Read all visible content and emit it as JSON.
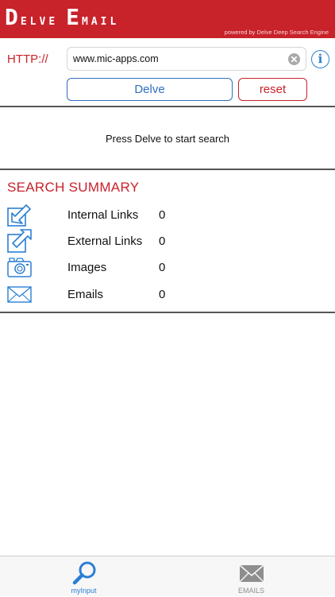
{
  "app": {
    "logo_word1_initial": "D",
    "logo_word1_rest": "ELVE",
    "logo_word2_initial": "E",
    "logo_word2_rest": "MAIL",
    "powered_by": "powered by Delve Deep Search Engine"
  },
  "input": {
    "protocol_label": "HTTP://",
    "url_value": "www.mic-apps.com",
    "clear_icon": "clear-icon",
    "info_icon": "info-icon",
    "info_glyph": "i"
  },
  "actions": {
    "delve_label": "Delve",
    "reset_label": "reset"
  },
  "status": {
    "message": "Press Delve to start search"
  },
  "summary": {
    "title": "SEARCH SUMMARY",
    "rows": [
      {
        "icon": "internal-link-icon",
        "label": "Internal Links",
        "count": "0"
      },
      {
        "icon": "external-link-icon",
        "label": "External Links",
        "count": "0"
      },
      {
        "icon": "camera-icon",
        "label": "Images",
        "count": "0"
      },
      {
        "icon": "envelope-icon",
        "label": "Emails",
        "count": "0"
      }
    ]
  },
  "tabbar": {
    "tabs": [
      {
        "label": "myInput",
        "icon": "magnifier-icon",
        "selected": true
      },
      {
        "label": "EMAILS",
        "icon": "envelope-icon",
        "selected": false
      }
    ]
  },
  "colors": {
    "brand_red": "#c8222a",
    "accent_blue": "#2b7fd4",
    "divider": "#555555"
  }
}
